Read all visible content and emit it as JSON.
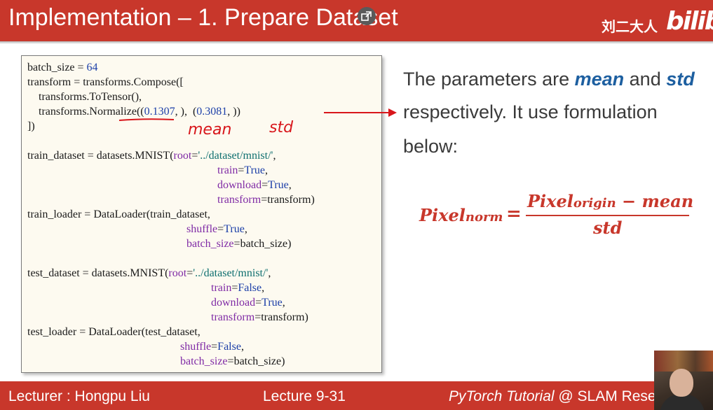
{
  "header": {
    "title": "Implementation – 1. Prepare Dataset",
    "author": "刘二大人",
    "logo": "bilibili"
  },
  "code": {
    "lines": [
      {
        "a": "batch_size = ",
        "n": "64"
      },
      {
        "a": "transform = transforms.Compose(["
      },
      {
        "a": "    transforms.ToTensor(),"
      },
      {
        "a": "    transforms.Normalize((",
        "n1": "0.1307",
        "b": ", ),  (",
        "n2": "0.3081",
        "c": ", ))"
      },
      {
        "a": "])"
      },
      {
        "a": ""
      },
      {
        "a": "train_dataset = datasets.MNIST(",
        "p": "root",
        "eq": "=",
        "s": "'../dataset/mnist/'",
        "e": ","
      },
      {
        "p": "train",
        "eq": "=",
        "k": "True",
        "e": ","
      },
      {
        "p": "download",
        "eq": "=",
        "k": "True",
        "e": ","
      },
      {
        "p": "transform",
        "eq": "=",
        "v": "transform)"
      },
      {
        "a": "train_loader = DataLoader(train_dataset,"
      },
      {
        "p": "shuffle",
        "eq": "=",
        "k": "True",
        "e": ","
      },
      {
        "p": "batch_size",
        "eq": "=",
        "v": "batch_size)"
      },
      {
        "a": ""
      },
      {
        "a": "test_dataset = datasets.MNIST(",
        "p": "root",
        "eq": "=",
        "s": "'../dataset/mnist/'",
        "e": ","
      },
      {
        "p": "train",
        "eq": "=",
        "k": "False",
        "e": ","
      },
      {
        "p": "download",
        "eq": "=",
        "k": "True",
        "e": ","
      },
      {
        "p": "transform",
        "eq": "=",
        "v": "transform)"
      },
      {
        "a": "test_loader = DataLoader(test_dataset,"
      },
      {
        "p": "shuffle",
        "eq": "=",
        "k": "False",
        "e": ","
      },
      {
        "p": "batch_size",
        "eq": "=",
        "v": "batch_size)"
      }
    ]
  },
  "annotations": {
    "mean": "mean",
    "std": "std"
  },
  "explanation": {
    "line1_a": "The parameters are ",
    "mean": "mean",
    "line1_b": " and ",
    "std": "std",
    "line2": "respectively. It use formulation",
    "line3": "below:"
  },
  "formula": {
    "lhs": "Pixel",
    "lhs_sub": "norm",
    "eq": "=",
    "num_a": "Pixel",
    "num_sub": "origin",
    "num_b": " − mean",
    "den": "std"
  },
  "footer": {
    "lecturer": "Lecturer : Hongpu Liu",
    "lecture": "Lecture 9-31",
    "course_italic": "PyTorch Tutorial",
    "course_rest": " @ SLAM Resea"
  },
  "colors": {
    "accent": "#c8372b",
    "keyword": "#1c3fa8",
    "string": "#0e6f6f",
    "param": "#7f2aa5",
    "highlight": "#1d5fa0",
    "ink": "#d8161b"
  }
}
